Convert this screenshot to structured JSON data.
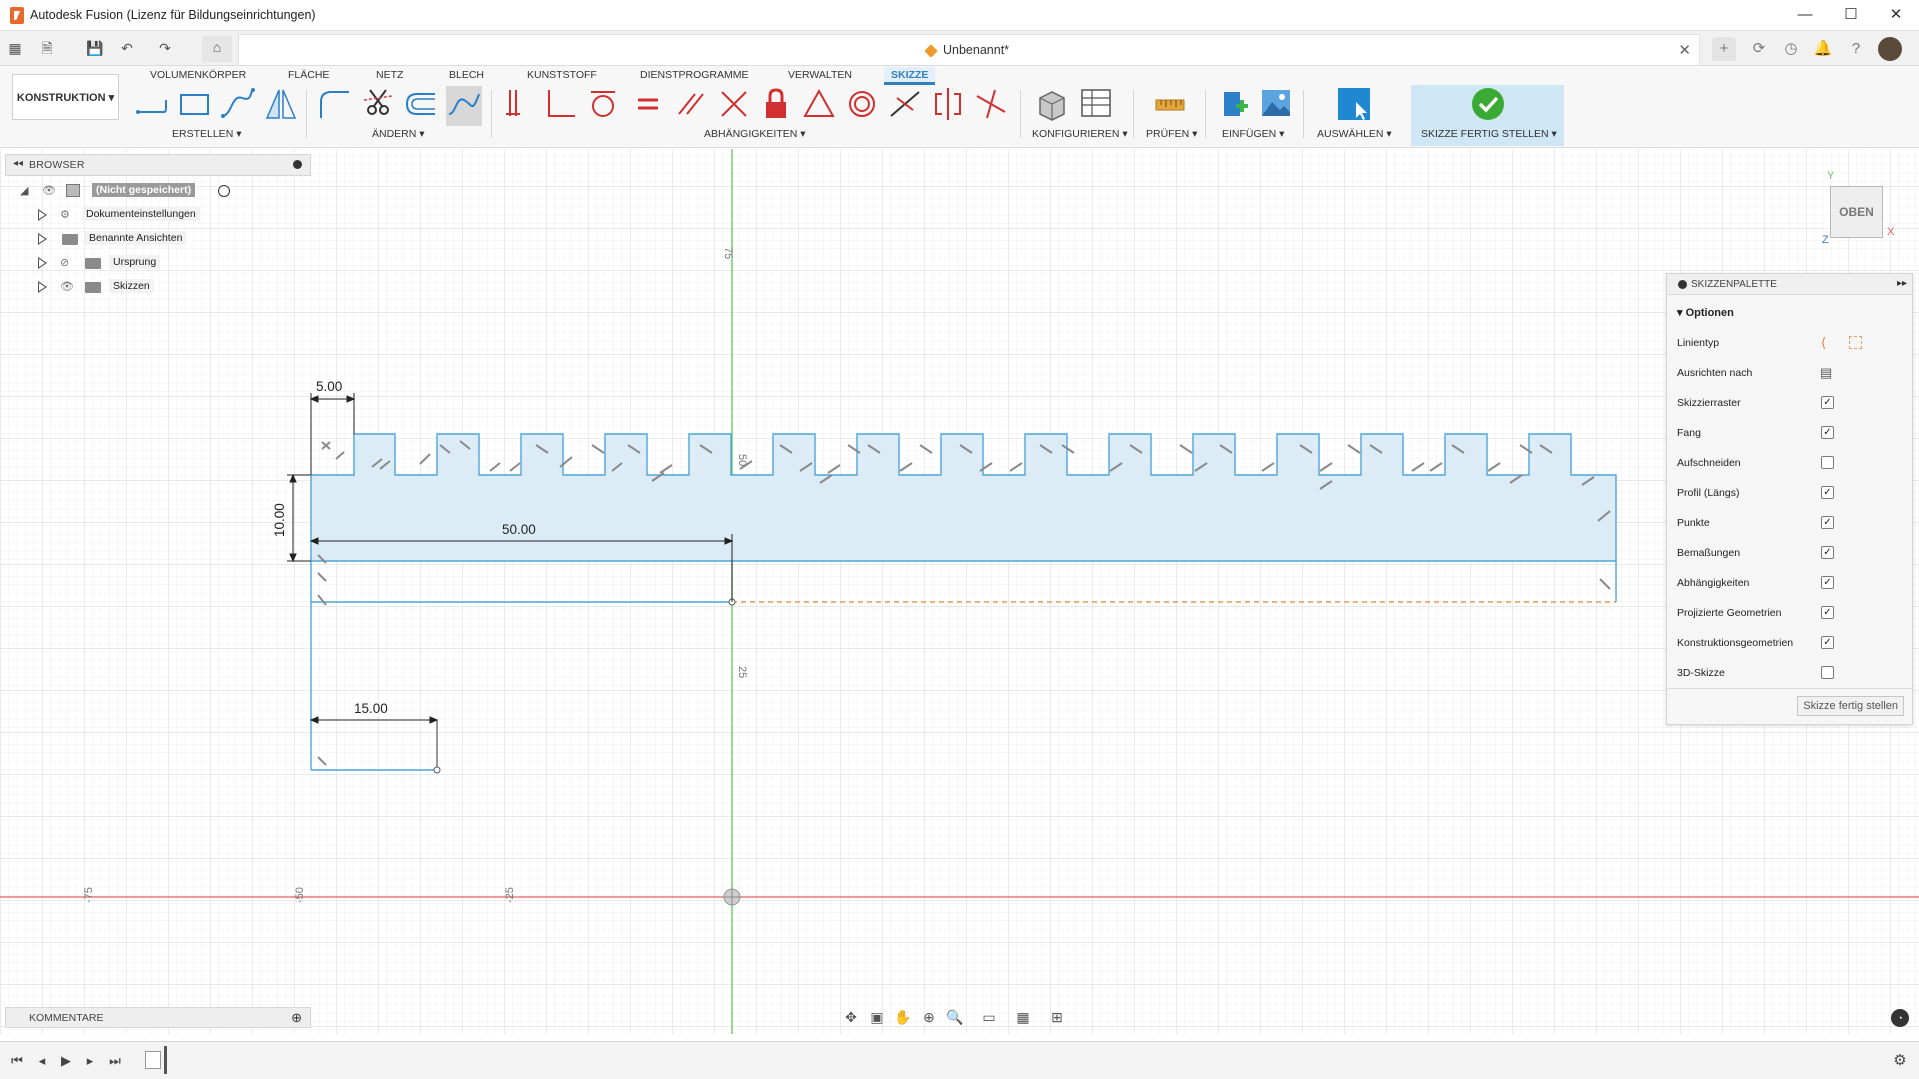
{
  "window": {
    "title": "Autodesk Fusion (Lizenz für Bildungseinrichtungen)",
    "minimize": "—",
    "maximize": "☐",
    "close": "✕"
  },
  "document": {
    "title": "Unbenannt*",
    "close": "✕"
  },
  "ribbon": {
    "workspace": "KONSTRUKTION ▾",
    "tabs": [
      "VOLUMENKÖRPER",
      "FLÄCHE",
      "NETZ",
      "BLECH",
      "KUNSTSTOFF",
      "DIENSTPROGRAMME",
      "VERWALTEN",
      "SKIZZE"
    ],
    "active_tab": "SKIZZE",
    "groups": {
      "create": "ERSTELLEN ▾",
      "modify": "ÄNDERN ▾",
      "constraints": "ABHÄNGIGKEITEN ▾",
      "configure": "KONFIGURIEREN ▾",
      "inspect": "PRÜFEN ▾",
      "insert": "EINFÜGEN ▾",
      "select": "AUSWÄHLEN ▾",
      "finish": "SKIZZE FERTIG STELLEN ▾"
    }
  },
  "browser": {
    "header": "BROWSER",
    "root": "(Nicht gespeichert)",
    "items": [
      {
        "label": "Dokumenteinstellungen",
        "icon": "gear-icon"
      },
      {
        "label": "Benannte Ansichten",
        "icon": "folder-icon"
      },
      {
        "label": "Ursprung",
        "icon": "folder-icon"
      },
      {
        "label": "Skizzen",
        "icon": "folder-icon"
      }
    ]
  },
  "palette": {
    "header": "SKIZZENPALETTE",
    "section": "Optionen",
    "rows": [
      {
        "label": "Linientyp",
        "type": "icons"
      },
      {
        "label": "Ausrichten nach",
        "type": "icon"
      },
      {
        "label": "Skizzierraster",
        "checked": true
      },
      {
        "label": "Fang",
        "checked": true
      },
      {
        "label": "Aufschneiden",
        "checked": false
      },
      {
        "label": "Profil (Längs)",
        "checked": true
      },
      {
        "label": "Punkte",
        "checked": true
      },
      {
        "label": "Bemaßungen",
        "checked": true
      },
      {
        "label": "Abhängigkeiten",
        "checked": true
      },
      {
        "label": "Projizierte Geometrien",
        "checked": true
      },
      {
        "label": "Konstruktionsgeometrien",
        "checked": true
      },
      {
        "label": "3D-Skizze",
        "checked": false
      }
    ],
    "finish_button": "Skizze fertig stellen"
  },
  "viewcube": {
    "face": "OBEN",
    "axis_x": "X",
    "axis_y": "Y",
    "axis_z": "Z"
  },
  "canvas": {
    "x_ticks": [
      "-75",
      "-50",
      "-25"
    ],
    "y_ticks": [
      "75",
      "50",
      "25"
    ],
    "dimensions": {
      "width_top": "5.00",
      "height_left": "10.00",
      "length": "50.00",
      "width_bottom": "15.00"
    }
  },
  "comments": {
    "header": "KOMMENTARE"
  },
  "colors": {
    "accent": "#2f7fc1",
    "x_axis": "#e06060",
    "y_axis": "#5cc85c",
    "sketch_line": "#4da6d9",
    "profile_fill": "#dcecf7"
  }
}
